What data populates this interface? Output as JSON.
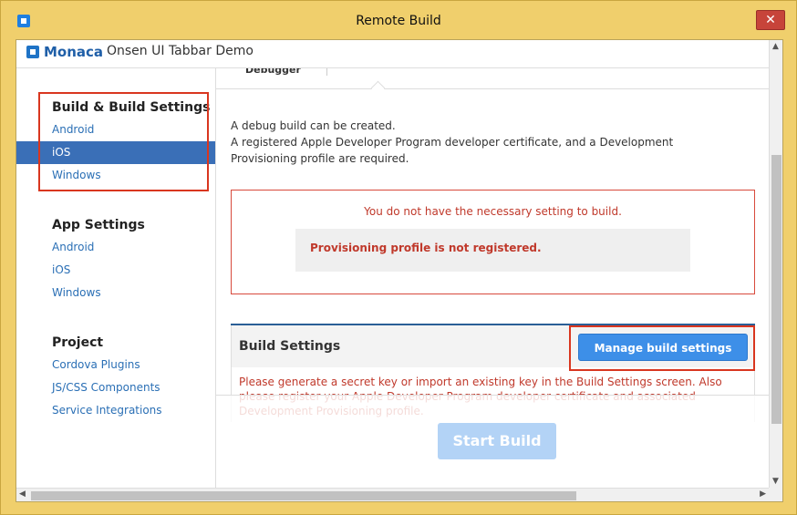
{
  "window": {
    "title": "Remote Build",
    "close_label": "✕"
  },
  "header": {
    "logo_text": "Monaca",
    "project_name": "Onsen UI Tabbar Demo"
  },
  "sidebar": {
    "sections": [
      {
        "title": "Build & Build Settings",
        "items": [
          "Android",
          "iOS",
          "Windows"
        ]
      },
      {
        "title": "App Settings",
        "items": [
          "Android",
          "iOS",
          "Windows"
        ]
      },
      {
        "title": "Project",
        "items": [
          "Cordova Plugins",
          "JS/CSS Components",
          "Service Integrations"
        ]
      }
    ],
    "active_item": "iOS"
  },
  "main": {
    "tab_partial": "Debugger",
    "description_lines": [
      "A debug build can be created.",
      "A registered Apple Developer Program developer certificate, and a Development",
      "Provisioning profile are required."
    ],
    "warning_text": "You do not have the necessary setting to build.",
    "warning_detail": "Provisioning profile is not registered.",
    "build_settings_title": "Build Settings",
    "manage_button": "Manage build settings",
    "build_settings_message": "Please generate a secret key or import an existing key in the Build Settings screen. Also please register your Apple Developer Program developer certificate and associated Development Provisioning profile.",
    "start_button": "Start Build"
  },
  "colors": {
    "accent": "#3a6fb7",
    "warning": "#c0392b",
    "highlight": "#d9361f",
    "window_frame": "#f0cf6c"
  }
}
